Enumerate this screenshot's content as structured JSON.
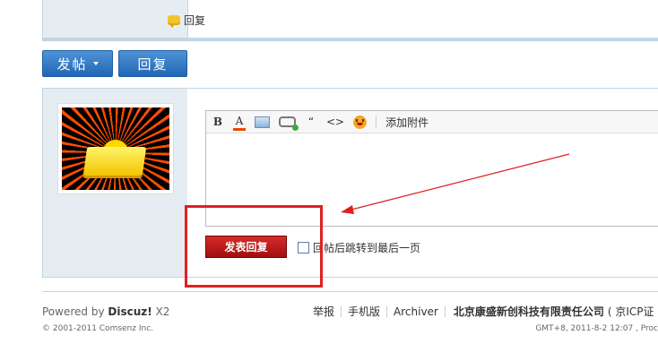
{
  "post": {
    "reply_link": "回复"
  },
  "actions": {
    "new_post_label": "发帖",
    "reply_label": "回复"
  },
  "editor": {
    "toolbar": {
      "bold": "B",
      "font_color": "A",
      "quote": "“",
      "code": "<>",
      "attach_label": "添加附件"
    },
    "content": ""
  },
  "quick_reply": {
    "submit_label": "发表回复",
    "jump_option_label": "回帖后跳转到最后一页",
    "jump_checked": false
  },
  "footer": {
    "powered_prefix": "Powered by ",
    "powered_brand": "Discuz!",
    "powered_version": " X2",
    "copyright": "© 2001-2011 Comsenz Inc.",
    "links": [
      "举报",
      "手机版",
      "Archiver"
    ],
    "company": "北京康盛新创科技有限责任公司",
    "icp": "( 京ICP证",
    "time": "GMT+8, 2011-8-2 12:07 , Proc"
  },
  "colors": {
    "annotation_red": "#e02020",
    "button_blue": "#2166b5",
    "submit_red": "#a10f0f",
    "sidebar_bg": "#e5edf2"
  }
}
